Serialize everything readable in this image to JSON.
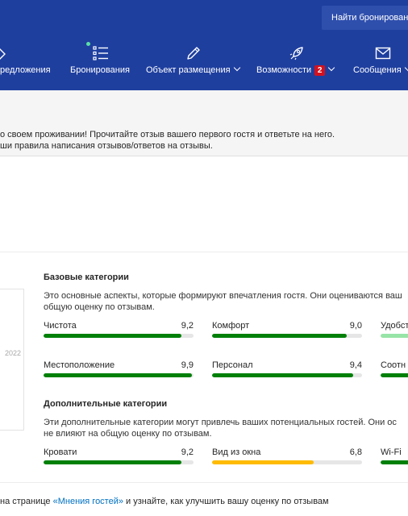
{
  "header": {
    "find_button": "Найти бронирован",
    "nav": [
      {
        "label": "редложения",
        "icon": "tag-icon"
      },
      {
        "label": "Бронирования",
        "icon": "list-icon"
      },
      {
        "label": "Объект размещения",
        "icon": "pencil-icon"
      },
      {
        "label": "Возможности",
        "icon": "rocket-icon",
        "badge": "2"
      },
      {
        "label": "Сообщения",
        "icon": "envelope-icon"
      }
    ]
  },
  "notice": {
    "line1": "о своем проживании! Прочитайте отзыв вашего первого гостя и ответьте на него.",
    "line2": "ши правила написания отзывов/ответов на отзывы."
  },
  "card": {
    "year": "2022"
  },
  "basic": {
    "title": "Базовые категории",
    "desc_line1": "Это основные аспекты, которые формируют впечатления гостя. Они оцениваются ваш",
    "desc_line2": "общую оценку по отзывам.",
    "metrics": [
      {
        "label": "Чистота",
        "value": "9,2",
        "score": 9.2,
        "color": "#008009"
      },
      {
        "label": "Комфорт",
        "value": "9,0",
        "score": 9.0,
        "color": "#008009"
      },
      {
        "label": "Удобст",
        "value": "",
        "score": 8.0,
        "color": "#97e5a7"
      },
      {
        "label": "Местоположение",
        "value": "9,9",
        "score": 9.9,
        "color": "#008009"
      },
      {
        "label": "Персонал",
        "value": "9,4",
        "score": 9.4,
        "color": "#008009"
      },
      {
        "label": "Соотн",
        "value": "",
        "score": 9.0,
        "color": "#008009"
      }
    ]
  },
  "extra": {
    "title": "Дополнительные категории",
    "desc_line1": "Эти дополнительные категории могут привлечь ваших потенциальных гостей. Они ос",
    "desc_line2": "не влияют на общую оценку по отзывам.",
    "metrics": [
      {
        "label": "Кровати",
        "value": "9,2",
        "score": 9.2,
        "color": "#008009"
      },
      {
        "label": "Вид из окна",
        "value": "6,8",
        "score": 6.8,
        "color": "#febb02"
      },
      {
        "label": "Wi-Fi",
        "value": "",
        "score": 9.0,
        "color": "#008009"
      }
    ]
  },
  "bottom": {
    "prefix": "на странице ",
    "link": "«Мнения гостей»",
    "suffix": " и узнайте, как улучшить вашу оценку по отзывам"
  }
}
